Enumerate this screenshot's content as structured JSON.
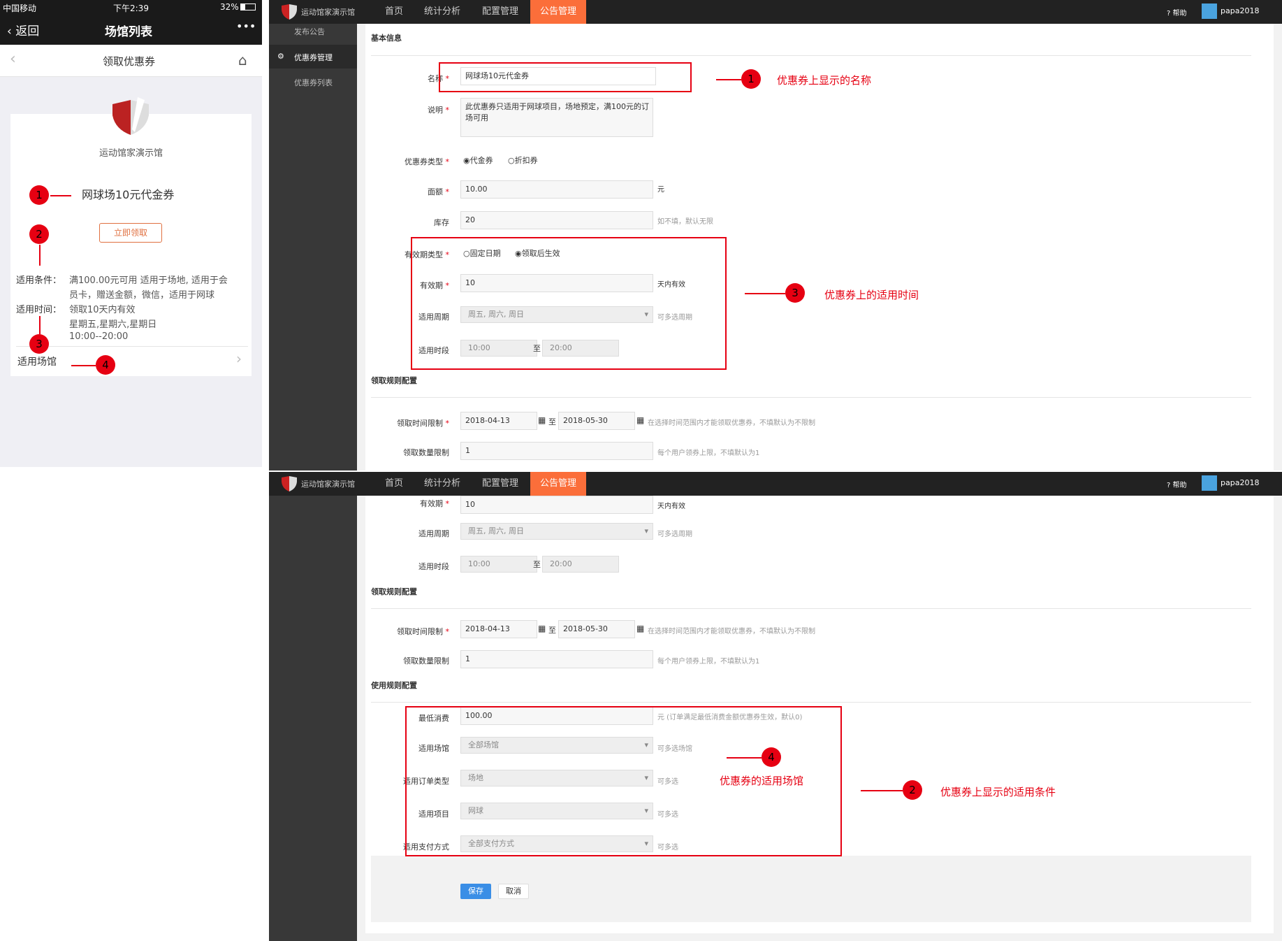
{
  "phone": {
    "status": {
      "carrier": "中国移动",
      "time": "下午2:39",
      "battery": "32%"
    },
    "nav": {
      "back": "返回",
      "title": "场馆列表",
      "more": "•••"
    },
    "sub_title": "领取优惠券",
    "venue_name": "运动馆家演示馆",
    "coupon_name": "网球场10元代金券",
    "claim_button": "立即领取",
    "cond_label": "适用条件：",
    "cond_text_1": "满100.00元可用 适用于场地,  适用于会",
    "cond_text_2": "员卡，赠送金额，微信，适用于网球",
    "time_label": "适用时间：",
    "time_text_1": "领取10天内有效",
    "time_text_2": "星期五,星期六,星期日",
    "time_text_3": "10:00--20:00",
    "venue_label": "适用场馆",
    "markers": [
      "1",
      "2",
      "3",
      "4"
    ]
  },
  "admin": {
    "brand": "运动馆家演示馆",
    "nav": [
      "首页",
      "统计分析",
      "配置管理",
      "公告管理"
    ],
    "help": "帮助",
    "user": "papa2018",
    "sidebar": {
      "publish": "发布公告",
      "coupon_mgmt": "优惠券管理",
      "coupon_list": "优惠券列表"
    },
    "basic_info": "基本信息",
    "f_name": "名称",
    "v_name": "网球场10元代金券",
    "f_desc": "说明",
    "v_desc": "此优惠券只适用于网球项目，场地预定，满100元的订场可用",
    "f_type": "优惠券类型",
    "opt_cash": "代金券",
    "opt_discount": "折扣券",
    "f_amount": "面额",
    "v_amount": "10.00",
    "u_amount": "元",
    "f_stock": "库存",
    "v_stock": "20",
    "h_stock": "如不填，默认无限",
    "f_valid_type": "有效期类型",
    "opt_fixed": "固定日期",
    "opt_after": "领取后生效",
    "f_valid": "有效期",
    "v_valid": "10",
    "u_valid": "天内有效",
    "f_week": "适用周期",
    "v_week": "周五, 周六, 周日",
    "h_week": "可多选周期",
    "f_period": "适用时段",
    "v_from": "10:00",
    "to": "至",
    "v_to": "20:00",
    "claim_sect": "领取规则配置",
    "f_claim_time": "领取时间限制",
    "v_date1": "2018-04-13",
    "v_date2": "2018-05-30",
    "h_claim_time": "在选择时间范围内才能领取优惠券，不填默认为不限制",
    "f_claim_qty": "领取数量限制",
    "v_claim_qty": "1",
    "h_claim_qty": "每个用户领券上限，不填默认为1",
    "use_sect": "使用规则配置",
    "f_min": "最低消费",
    "v_min": "100.00",
    "h_min": "元 (订单满足最低消费金额优惠券生效，默认0)",
    "f_venue": "适用场馆",
    "v_venue": "全部场馆",
    "h_venue": "可多选场馆",
    "f_order": "适用订单类型",
    "v_order": "场地",
    "h_multi": "可多选",
    "f_item": "适用项目",
    "v_item": "网球",
    "f_pay": "适用支付方式",
    "v_pay": "全部支付方式",
    "save": "保存",
    "cancel": "取消"
  },
  "annotations": {
    "a1": "优惠券上显示的名称",
    "a3": "优惠券上的适用时间",
    "a4": "优惠券的适用场馆",
    "a2": "优惠券上显示的适用条件"
  }
}
